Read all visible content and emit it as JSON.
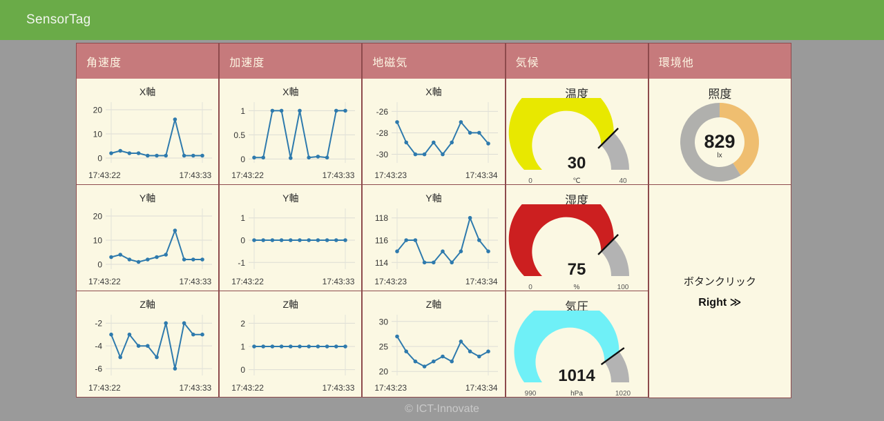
{
  "header": {
    "title": "SensorTag"
  },
  "footer": {
    "text": "© ICT-Innovate"
  },
  "colors": {
    "appbar": "#6aab48",
    "card_header": "#c67a7c",
    "card_border": "#8d4a4c",
    "card_body": "#fbf8e3",
    "line": "#2e7aad",
    "page_bg": "#9a9a9a",
    "gauge_temp": "#e8e800",
    "gauge_humidity": "#cc1f20",
    "gauge_pressure": "#6ff0f7",
    "gauge_track": "#b3b3b3",
    "donut_value": "#efbe70",
    "donut_track": "#b0b0ad"
  },
  "columns": [
    {
      "id": "angular-velocity",
      "header": "角速度"
    },
    {
      "id": "acceleration",
      "header": "加速度"
    },
    {
      "id": "geomagnetism",
      "header": "地磁気"
    },
    {
      "id": "climate",
      "header": "気候"
    },
    {
      "id": "environment-other",
      "header": "環境他"
    }
  ],
  "button_panel": {
    "label": "ボタンクリック",
    "value": "Right ≫"
  },
  "chart_data": [
    {
      "id": "gyro-x",
      "type": "line",
      "title": "X軸",
      "ylabel": "",
      "xlabel": "",
      "yticks": [
        0,
        10,
        20
      ],
      "ylim": [
        -2,
        22
      ],
      "x_start": "17:43:22",
      "x_end": "17:43:33",
      "values": [
        2,
        3,
        2,
        2,
        1,
        1,
        1,
        16,
        1,
        1,
        1
      ],
      "grid": true,
      "legend": "none"
    },
    {
      "id": "gyro-y",
      "type": "line",
      "title": "Y軸",
      "yticks": [
        0,
        10,
        20
      ],
      "ylim": [
        -2,
        22
      ],
      "x_start": "17:43:22",
      "x_end": "17:43:33",
      "values": [
        3,
        4,
        2,
        1,
        2,
        3,
        4,
        14,
        2,
        2,
        2
      ],
      "grid": true,
      "legend": "none"
    },
    {
      "id": "gyro-z",
      "type": "line",
      "title": "Z軸",
      "yticks": [
        -6,
        -4,
        -2
      ],
      "ylim": [
        -6.6,
        -1.5
      ],
      "x_start": "17:43:22",
      "x_end": "17:43:33",
      "values": [
        -3,
        -5,
        -3,
        -4,
        -4,
        -5,
        -2,
        -6,
        -2,
        -3,
        -3
      ],
      "grid": true,
      "legend": "none"
    },
    {
      "id": "accel-x",
      "type": "line",
      "title": "X軸",
      "yticks": [
        0,
        0.5,
        1.0
      ],
      "ylim": [
        -0.08,
        1.12
      ],
      "x_start": "17:43:22",
      "x_end": "17:43:33",
      "values": [
        0.03,
        0.03,
        1.0,
        1.0,
        0.02,
        1.0,
        0.03,
        0.05,
        0.03,
        1.0,
        1.0
      ],
      "grid": true,
      "legend": "none"
    },
    {
      "id": "accel-y",
      "type": "line",
      "title": "Y軸",
      "yticks": [
        -1,
        0,
        1
      ],
      "ylim": [
        -1.3,
        1.3
      ],
      "x_start": "17:43:22",
      "x_end": "17:43:33",
      "values": [
        0,
        0,
        0,
        0,
        0,
        0,
        0,
        0,
        0,
        0,
        0
      ],
      "grid": true,
      "legend": "none"
    },
    {
      "id": "accel-z",
      "type": "line",
      "title": "Z軸",
      "yticks": [
        0,
        1,
        2
      ],
      "ylim": [
        -0.25,
        2.25
      ],
      "x_start": "17:43:22",
      "x_end": "17:43:33",
      "values": [
        1,
        1,
        1,
        1,
        1,
        1,
        1,
        1,
        1,
        1,
        1
      ],
      "grid": true,
      "legend": "none"
    },
    {
      "id": "mag-x",
      "type": "line",
      "title": "X軸",
      "yticks": [
        -30,
        -28,
        -26
      ],
      "ylim": [
        -30.8,
        -25.4
      ],
      "x_start": "17:43:23",
      "x_end": "17:43:34",
      "values": [
        -27,
        -28.9,
        -30,
        -30,
        -28.9,
        -30,
        -28.9,
        -27,
        -28,
        -28,
        -29
      ],
      "grid": true,
      "legend": "none"
    },
    {
      "id": "mag-y",
      "type": "line",
      "title": "Y軸",
      "yticks": [
        114,
        116,
        118
      ],
      "ylim": [
        113.4,
        118.6
      ],
      "x_start": "17:43:23",
      "x_end": "17:43:34",
      "values": [
        115,
        116,
        116,
        114,
        114,
        115,
        114,
        115,
        118,
        116,
        115
      ],
      "grid": true,
      "legend": "none"
    },
    {
      "id": "mag-z",
      "type": "line",
      "title": "Z軸",
      "yticks": [
        20,
        25,
        30
      ],
      "ylim": [
        19.2,
        30.8
      ],
      "x_start": "17:43:23",
      "x_end": "17:43:34",
      "values": [
        27,
        24,
        22,
        21,
        22,
        23,
        22,
        26,
        24,
        23,
        24
      ],
      "grid": true,
      "legend": "none"
    },
    {
      "id": "temperature",
      "type": "gauge",
      "title": "温度",
      "value": 30,
      "min": 0,
      "max": 40,
      "min_label": "0",
      "max_label": "40",
      "unit": "℃",
      "color": "#e8e800"
    },
    {
      "id": "humidity",
      "type": "gauge",
      "title": "湿度",
      "value": 75,
      "min": 0,
      "max": 100,
      "min_label": "0",
      "max_label": "100",
      "unit": "%",
      "color": "#cc1f20"
    },
    {
      "id": "pressure",
      "type": "gauge",
      "title": "気圧",
      "value": 1014,
      "min": 990,
      "max": 1020,
      "min_label": "990",
      "max_label": "1020",
      "unit": "hPa",
      "color": "#6ff0f7"
    },
    {
      "id": "illuminance",
      "type": "donut",
      "title": "照度",
      "value": 829,
      "unit": "lx",
      "fraction": 0.41,
      "color": "#efbe70",
      "track": "#b0b0ad"
    }
  ]
}
